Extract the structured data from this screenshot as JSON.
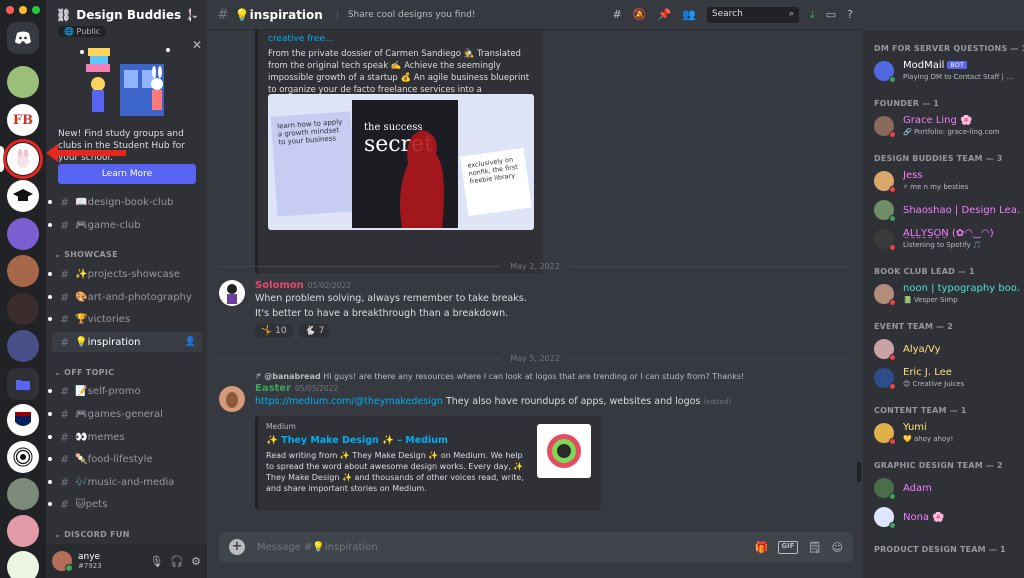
{
  "window": {
    "traffic_colors": [
      "#ff5f57",
      "#febc2e",
      "#28c840"
    ]
  },
  "server": {
    "name": "Design Buddies 🐰",
    "public_label": "Public"
  },
  "promo": {
    "text": "New! Find study groups and clubs in the Student Hub for your school.",
    "button": "Learn More"
  },
  "channels": {
    "top": [
      {
        "name": "📖design-book-club"
      },
      {
        "name": "🎮game-club"
      }
    ],
    "categories": [
      {
        "name": "SHOWCASE",
        "items": [
          {
            "name": "✨projects-showcase"
          },
          {
            "name": "🎨art-and-photography"
          },
          {
            "name": "🏆victories"
          },
          {
            "name": "💡inspiration"
          }
        ]
      },
      {
        "name": "OFF TOPIC",
        "items": [
          {
            "name": "📝self-promo"
          },
          {
            "name": "🎮games-general"
          },
          {
            "name": "👀memes"
          },
          {
            "name": "🍡food-lifestyle"
          },
          {
            "name": "🎶music-and-media"
          },
          {
            "name": "🐱pets"
          }
        ]
      },
      {
        "name": "DISCORD FUN",
        "items": []
      }
    ]
  },
  "user": {
    "name": "anye",
    "tag": "#7923"
  },
  "header": {
    "channel": "💡inspiration",
    "topic": "Share cool designs you find!",
    "search_placeholder": "Search"
  },
  "embed1": {
    "title": "creative free...",
    "description": "From the private dossier of Carmen Sandiego 🕵️ Translated from the original tech speak ✍️ Achieve the seemingly impossible growth of a startup 💰 An agile business blueprint to organize your de facto freelance services into a sustainable one-person agency",
    "card_left": "learn how to apply a growth mindset to your business",
    "book_line1": "the success",
    "book_line2": "secret",
    "card_right": "exclusively on nonfik, the first freebie library"
  },
  "dividers": [
    "May 2, 2022",
    "May 5, 2022"
  ],
  "messages": [
    {
      "author": "Solomon",
      "author_color": "#e4476c",
      "timestamp": "05/02/2022",
      "lines": [
        "When problem solving, always remember to take breaks.",
        "It's better to have a breakthrough than a breakdown."
      ],
      "reactions": [
        {
          "emoji": "🤸",
          "count": "10"
        },
        {
          "emoji": "🐇",
          "count": "7"
        }
      ]
    },
    {
      "reply_author": "@banabread",
      "reply_text": "Hi guys! are there any resources where I can look at logos that are trending or I can study from? Thanks!",
      "author": "Easter",
      "author_color": "#3ba55d",
      "timestamp": "05/05/2022",
      "link": "https://medium.com/@theymakedesign",
      "text": " They also have roundups of apps, websites and logos ",
      "edited": "(edited)",
      "embed": {
        "provider": "Medium",
        "title": "✨ They Make Design ✨ – Medium",
        "description": "Read writing from ✨ They Make Design ✨ on Medium. We help to spread the word about awesome design works. Every day, ✨ They Make Design ✨ and thousands of other voices read, write, and share important stories on Medium."
      }
    }
  ],
  "composer": {
    "placeholder": "Message #💡inspiration"
  },
  "members": {
    "groups": [
      {
        "role": "DM FOR SERVER QUESTIONS — 1",
        "people": [
          {
            "name": "ModMail",
            "color": "#ffffff",
            "bot": "BOT",
            "status": "Playing DM to Contact Staff | ...",
            "presence": "#3ba55d",
            "avatar": "#4f6ae0"
          }
        ]
      },
      {
        "role": "FOUNDER — 1",
        "people": [
          {
            "name": "Grace Ling 🌸",
            "color": "#f47fff",
            "status": "🔗 Portfolio: grace-ling.com",
            "presence": "#ed4245",
            "avatar": "#8a6a5a"
          }
        ]
      },
      {
        "role": "DESIGN BUDDIES TEAM — 3",
        "people": [
          {
            "name": "Jess",
            "color": "#f47fff",
            "status": "⚡ me n my besties",
            "presence": "#ed4245",
            "avatar": "#d9a76a"
          },
          {
            "name": "Shaoshao | Design Lea...",
            "color": "#f47fff",
            "status": "",
            "presence": "#3ba55d",
            "avatar": "#6f8d66"
          },
          {
            "name": "A̤L̤L̤Y̤S̤O̤N̤ (✿◠‿◠)",
            "color": "#f47fff",
            "status": "Listening to Spotify 🎵",
            "presence": "#ed4245",
            "avatar": "#3a3a3a"
          }
        ]
      },
      {
        "role": "BOOK CLUB LEAD — 1",
        "people": [
          {
            "name": "noon | typography boo...",
            "color": "#4ee5c9",
            "status": "📗 Vesper Simp",
            "presence": "#ed4245",
            "avatar": "#b48c7a"
          }
        ]
      },
      {
        "role": "EVENT TEAM — 2",
        "people": [
          {
            "name": "Alya/Vy",
            "color": "#ffe07a",
            "status": "",
            "presence": "#ed4245",
            "avatar": "#c9a3a3"
          },
          {
            "name": "Eric J. Lee",
            "color": "#ffe07a",
            "status": "😊 Creative Juices",
            "presence": "#ed4245",
            "avatar": "#2d4e8a"
          }
        ]
      },
      {
        "role": "CONTENT TEAM — 1",
        "people": [
          {
            "name": "Yumi",
            "color": "#ffe07a",
            "status": "💛 ahoy ahoy!",
            "presence": "#ed4245",
            "avatar": "#e0b04a"
          }
        ]
      },
      {
        "role": "GRAPHIC DESIGN TEAM — 2",
        "people": [
          {
            "name": "Adam",
            "color": "#f47fff",
            "status": "",
            "presence": "#3ba55d",
            "avatar": "#4a6d4a"
          },
          {
            "name": "Nona 🌸",
            "color": "#f47fff",
            "status": "",
            "presence": "#3ba55d",
            "avatar": "#dfe4ff"
          }
        ]
      },
      {
        "role": "PRODUCT DESIGN TEAM — 1",
        "people": []
      }
    ]
  }
}
